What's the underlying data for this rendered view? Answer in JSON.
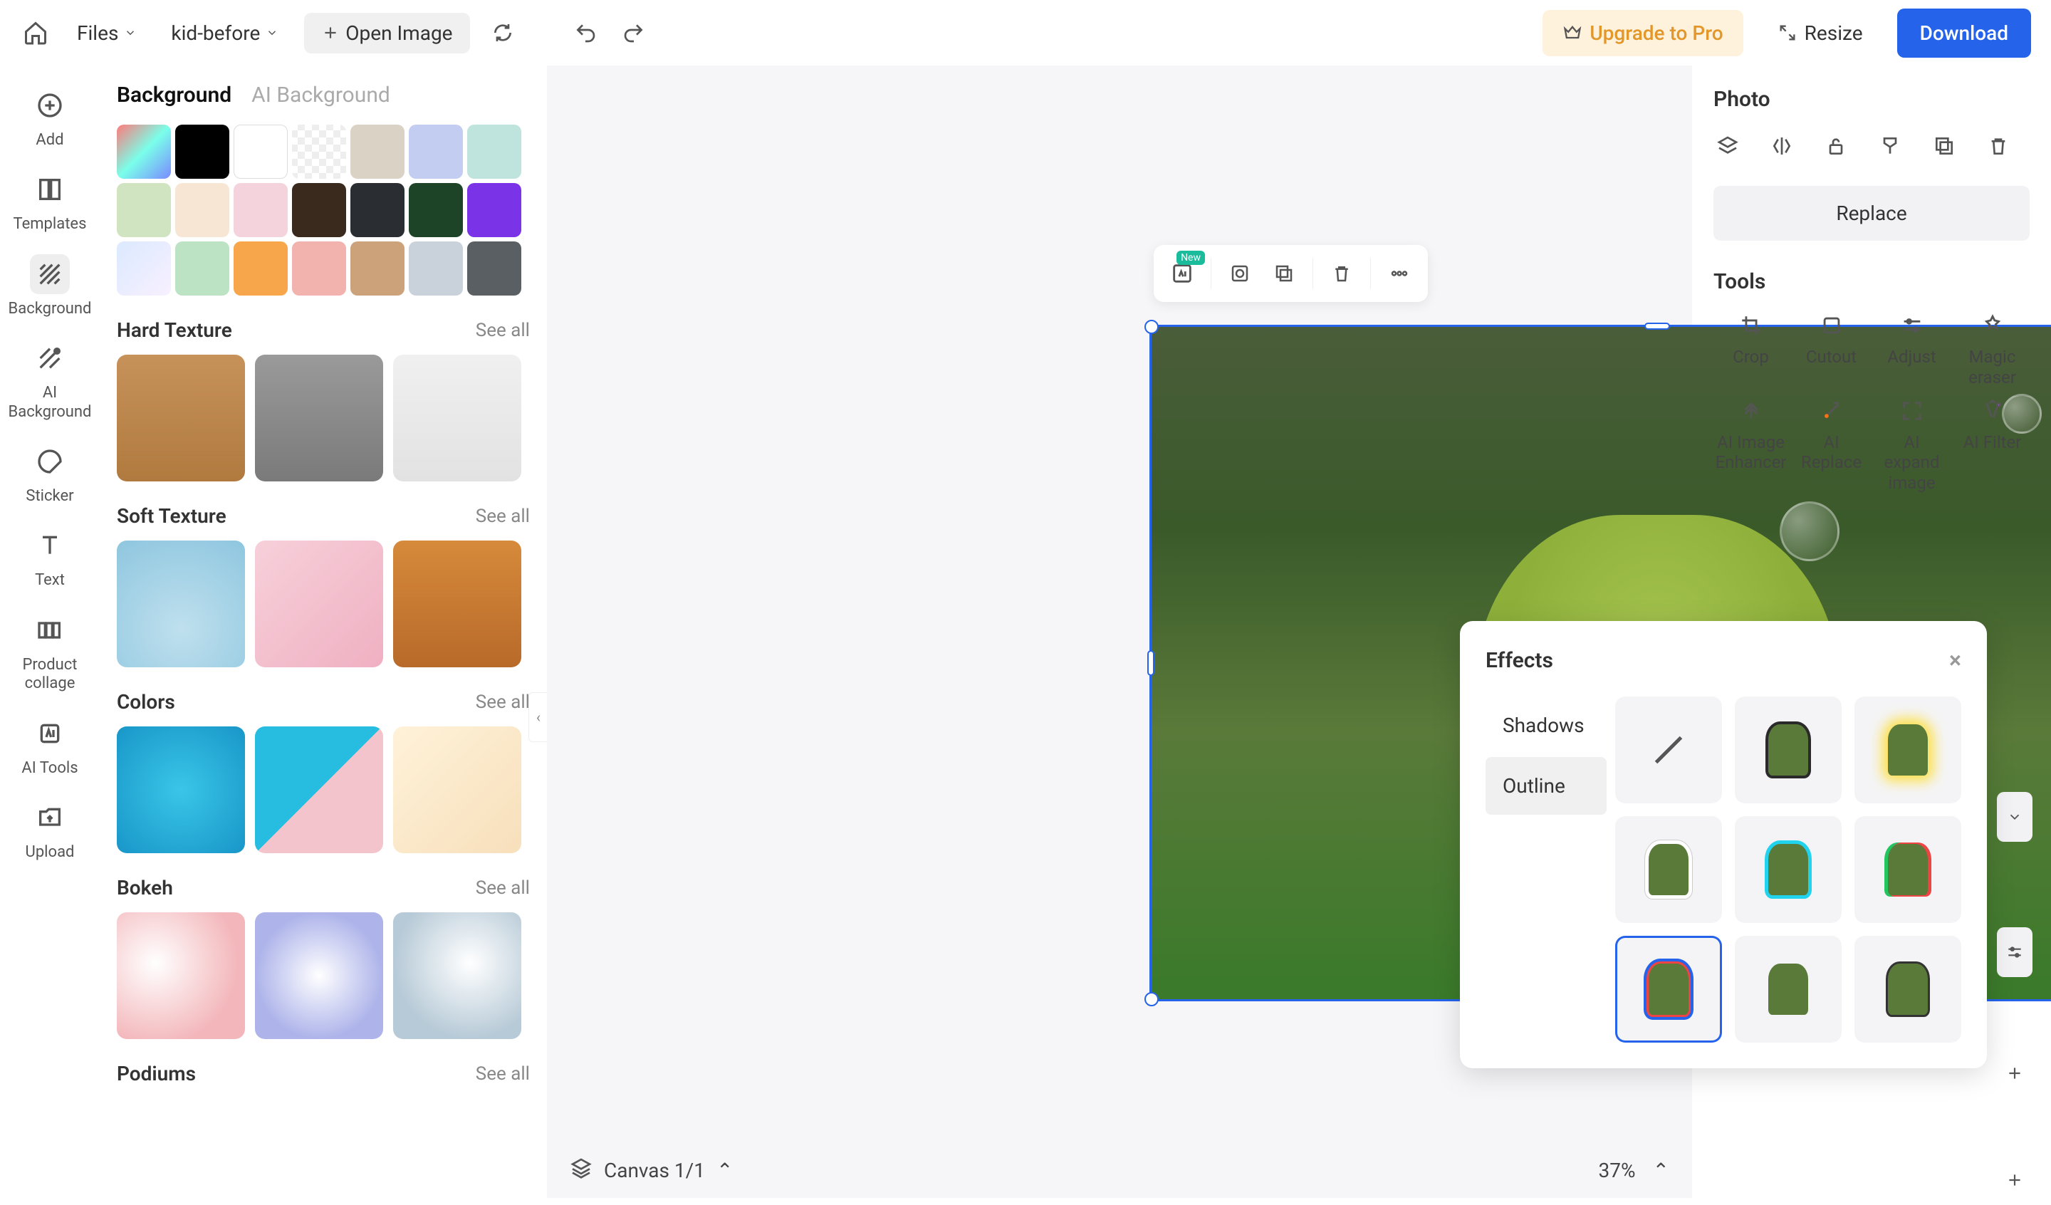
{
  "topbar": {
    "files_label": "Files",
    "project_name": "kid-before",
    "open_image_label": "Open Image",
    "upgrade_label": "Upgrade to Pro",
    "resize_label": "Resize",
    "download_label": "Download"
  },
  "sidebar": {
    "items": [
      {
        "id": "add",
        "label": "Add"
      },
      {
        "id": "templates",
        "label": "Templates"
      },
      {
        "id": "background",
        "label": "Background",
        "active": true
      },
      {
        "id": "ai-background",
        "label": "AI Background"
      },
      {
        "id": "sticker",
        "label": "Sticker"
      },
      {
        "id": "text",
        "label": "Text"
      },
      {
        "id": "product-collage",
        "label": "Product collage"
      },
      {
        "id": "ai-tools",
        "label": "AI Tools"
      },
      {
        "id": "upload",
        "label": "Upload"
      }
    ]
  },
  "bg_panel": {
    "tabs": {
      "background": "Background",
      "ai_background": "AI Background"
    },
    "swatches": [
      "linear-gradient(135deg,#ff7a7a,#7affea,#7a8aff)",
      "#000000",
      "#ffffff",
      "repeating-conic-gradient(#eee 0 25%, #fff 0 50%) 50% / 20px 20px",
      "#d9d2c5",
      "#c3cdf2",
      "#bfe4de",
      "#d0e4c2",
      "#f7e6d4",
      "#f5d3dc",
      "#3a2a1e",
      "#2a2e33",
      "#1e4427",
      "#7a33e6",
      "linear-gradient(135deg,#dbe9ff,#f8f0ff)",
      "#bce3c3",
      "#f7a64b",
      "#f2b3ae",
      "#cba27a",
      "#c9d1db",
      "#5a5f63"
    ],
    "selected_swatch_index": 2,
    "see_all_label": "See all",
    "sections": [
      {
        "title": "Hard Texture",
        "thumbs": [
          "linear-gradient(#c7925a,#b07a3f)",
          "linear-gradient(#9a9a9a,#7a7a7a)",
          "linear-gradient(#f0f0f0,#e2e2e2)"
        ]
      },
      {
        "title": "Soft Texture",
        "thumbs": [
          "radial-gradient(circle at 50% 70%,#bfe0ee,#8ec6df)",
          "linear-gradient(135deg,#f7d0da,#efb0c2)",
          "linear-gradient(#d68a3a,#b86a2a)"
        ]
      },
      {
        "title": "Colors",
        "thumbs": [
          "radial-gradient(circle,#3ac6e8,#1896c8)",
          "linear-gradient(135deg,#27bde0 50%,#f4c4cc 50%)",
          "linear-gradient(135deg,#fff2d9,#f7dfbb)"
        ]
      },
      {
        "title": "Bokeh",
        "thumbs": [
          "radial-gradient(circle at 30% 40%,#fff,#f3b7bb 70%)",
          "radial-gradient(circle at 50% 50%,#fff,#aeb4ea 70%)",
          "radial-gradient(circle at 60% 40%,#fff,#b7cad7 70%)"
        ]
      },
      {
        "title": "Podiums",
        "thumbs": []
      }
    ]
  },
  "float_toolbar": {
    "new_badge": "New"
  },
  "canvas": {
    "footer_label": "Canvas 1/1",
    "zoom": "37%"
  },
  "right_panel": {
    "title": "Photo",
    "replace_label": "Replace",
    "tools_title": "Tools",
    "tools": [
      {
        "id": "crop",
        "label": "Crop"
      },
      {
        "id": "cutout",
        "label": "Cutout"
      },
      {
        "id": "adjust",
        "label": "Adjust"
      },
      {
        "id": "magic-eraser",
        "label": "Magic eraser"
      },
      {
        "id": "ai-image-enhancer",
        "label": "AI Image Enhancer"
      },
      {
        "id": "ai-replace",
        "label": "AI Replace"
      },
      {
        "id": "ai-expand-image",
        "label": "AI expand image"
      },
      {
        "id": "ai-filter",
        "label": "AI Filter"
      }
    ]
  },
  "effects_popup": {
    "title": "Effects",
    "tabs": {
      "shadows": "Shadows",
      "outline": "Outline"
    },
    "active_tab": "outline",
    "selected_outline_index": 6,
    "outlines": [
      {
        "style": "none"
      },
      {
        "style": "dark"
      },
      {
        "style": "yellow-glow"
      },
      {
        "style": "white"
      },
      {
        "style": "cyan"
      },
      {
        "style": "multi"
      },
      {
        "style": "red-blue"
      },
      {
        "style": "plain1"
      },
      {
        "style": "plain2"
      }
    ]
  }
}
